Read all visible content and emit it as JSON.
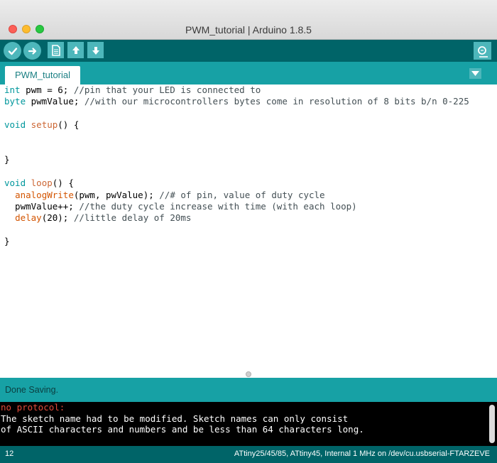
{
  "window": {
    "title": "PWM_tutorial | Arduino 1.8.5"
  },
  "toolbar": {
    "buttons": [
      {
        "name": "verify",
        "icon": "checkmark-icon"
      },
      {
        "name": "upload",
        "icon": "arrow-right-icon"
      },
      {
        "name": "new",
        "icon": "new-file-icon"
      },
      {
        "name": "open",
        "icon": "arrow-up-icon"
      },
      {
        "name": "save",
        "icon": "arrow-down-icon"
      },
      {
        "name": "serial-monitor",
        "icon": "magnifier-icon"
      }
    ]
  },
  "tabs": [
    {
      "label": "PWM_tutorial",
      "active": true
    }
  ],
  "editor": {
    "lines": [
      [
        {
          "t": "int",
          "c": "kw"
        },
        {
          "t": " pwm = 6; ",
          "c": ""
        },
        {
          "t": "//pin that your LED is connected to",
          "c": "cm"
        }
      ],
      [
        {
          "t": "byte",
          "c": "kw"
        },
        {
          "t": " pwmValue; ",
          "c": ""
        },
        {
          "t": "//with our microcontrollers bytes come in resolution of 8 bits b/n 0-225",
          "c": "cm"
        }
      ],
      [],
      [
        {
          "t": "void",
          "c": "kw"
        },
        {
          "t": " ",
          "c": ""
        },
        {
          "t": "setup",
          "c": "ty"
        },
        {
          "t": "() {",
          "c": ""
        }
      ],
      [],
      [],
      [
        {
          "t": "}",
          "c": ""
        }
      ],
      [],
      [
        {
          "t": "void",
          "c": "kw"
        },
        {
          "t": " ",
          "c": ""
        },
        {
          "t": "loop",
          "c": "ty"
        },
        {
          "t": "() {",
          "c": ""
        }
      ],
      [
        {
          "t": "  ",
          "c": ""
        },
        {
          "t": "analogWrite",
          "c": "fn"
        },
        {
          "t": "(pwm, pwValue); ",
          "c": ""
        },
        {
          "t": "//# of pin, value of duty cycle",
          "c": "cm"
        }
      ],
      [
        {
          "t": "  pwmValue++; ",
          "c": ""
        },
        {
          "t": "//the duty cycle increase with time (with each loop)",
          "c": "cm"
        }
      ],
      [
        {
          "t": "  ",
          "c": ""
        },
        {
          "t": "delay",
          "c": "fn"
        },
        {
          "t": "(20); ",
          "c": ""
        },
        {
          "t": "//little delay of 20ms",
          "c": "cm"
        }
      ],
      [],
      [
        {
          "t": "}",
          "c": ""
        }
      ]
    ]
  },
  "status": {
    "message": "Done Saving."
  },
  "console": {
    "error_line": "no protocol:",
    "lines": [
      "The sketch name had to be modified. Sketch names can only consist",
      "of ASCII characters and numbers and be less than 64 characters long."
    ]
  },
  "bottom": {
    "line_number": "12",
    "board_info": "ATtiny25/45/85, ATtiny45, Internal 1 MHz on /dev/cu.usbserial-FTARZEVE"
  },
  "colors": {
    "toolbar": "#006468",
    "tabbar": "#17a1a5",
    "button": "#4db7bb",
    "keyword": "#00979c",
    "function": "#d35400",
    "console_error": "#e24b3a"
  }
}
